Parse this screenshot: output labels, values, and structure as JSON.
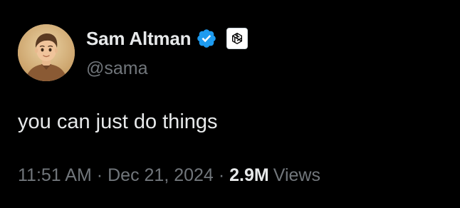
{
  "user": {
    "display_name": "Sam Altman",
    "handle": "@sama",
    "avatar_icon": "profile-avatar",
    "verified_icon": "verified-badge-icon",
    "affiliate_icon": "openai-logo-icon"
  },
  "tweet": {
    "text": "you can just do things"
  },
  "meta": {
    "time": "11:51 AM",
    "separator": "·",
    "date": "Dec 21, 2024",
    "views_count": "2.9M",
    "views_label": "Views"
  },
  "colors": {
    "background": "#000000",
    "primary_text": "#e7e9ea",
    "secondary_text": "#71767b",
    "verified_blue": "#1d9bf0"
  }
}
